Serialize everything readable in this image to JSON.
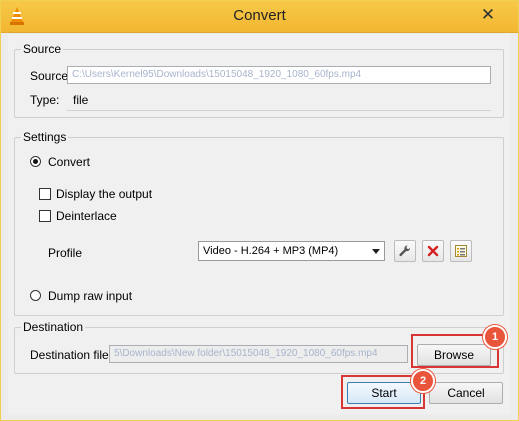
{
  "window": {
    "title": "Convert",
    "close_glyph": "✕"
  },
  "source": {
    "legend": "Source",
    "source_label": "Source:",
    "source_value": "C:\\Users\\Kernel95\\Downloads\\15015048_1920_1080_60fps.mp4",
    "type_label": "Type:",
    "type_value": "file"
  },
  "settings": {
    "legend": "Settings",
    "convert_label": "Convert",
    "convert_checked": true,
    "display_output_label": "Display the output",
    "deinterlace_label": "Deinterlace",
    "profile_label": "Profile",
    "profile_selected": "Video - H.264 + MP3 (MP4)",
    "dump_raw_label": "Dump raw input"
  },
  "destination": {
    "legend": "Destination",
    "file_label": "Destination file:",
    "file_value": "5\\Downloads\\New folder\\15015048_1920_1080_60fps.mp4",
    "browse_label": "Browse"
  },
  "actions": {
    "start_label": "Start",
    "cancel_label": "Cancel"
  },
  "callouts": {
    "badge_1": "1",
    "badge_2": "2"
  },
  "icons": {
    "app": "vlc-cone-icon",
    "edit_profile": "wrench-icon",
    "delete_profile": "red-x-icon",
    "new_profile": "profile-list-icon"
  },
  "colors": {
    "title_bar": "#f2b632",
    "callout": "#d93535",
    "badge": "#e9553a"
  }
}
